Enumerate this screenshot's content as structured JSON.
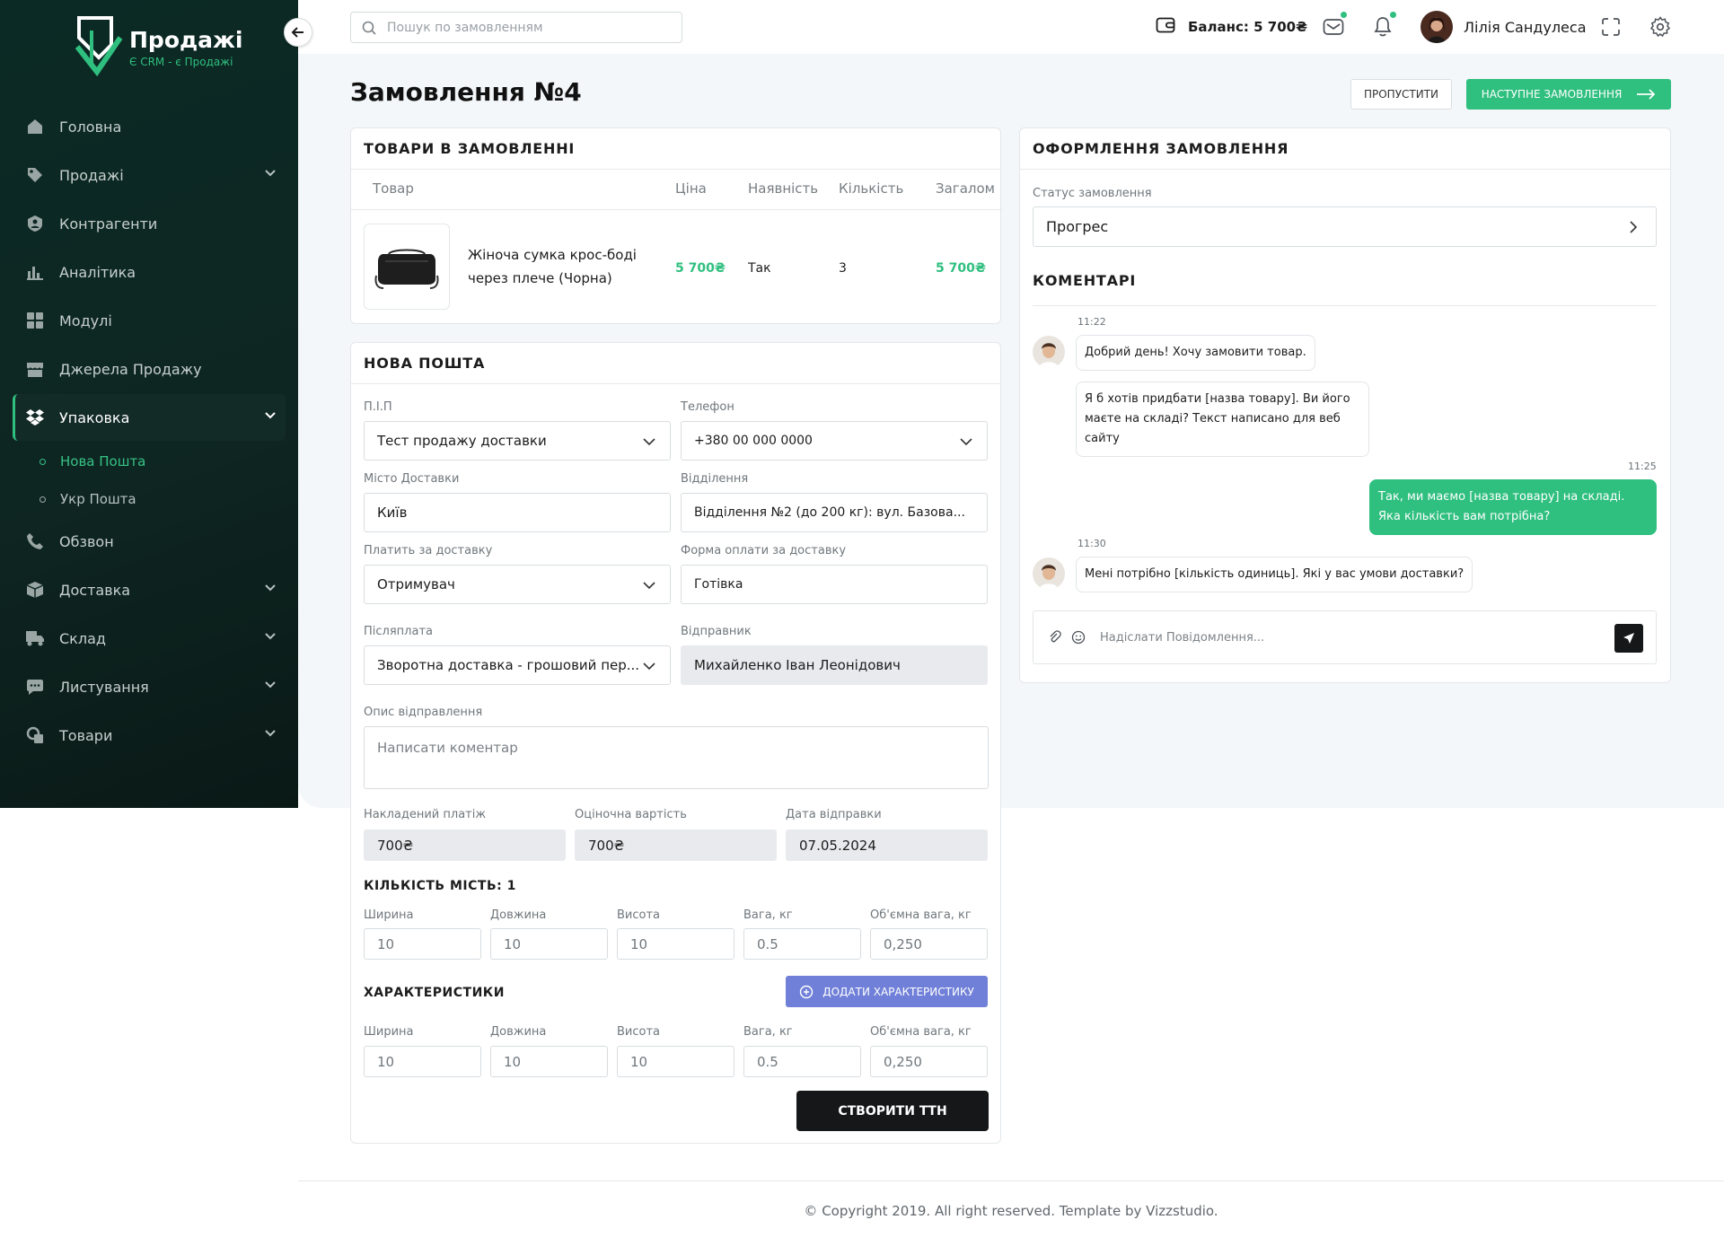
{
  "brand": {
    "title": "Продажі",
    "subtitle": "Є CRM - є Продажі"
  },
  "sidebar": {
    "items": [
      {
        "label": "Головна",
        "icon": "home-icon",
        "expandable": false
      },
      {
        "label": "Продажі",
        "icon": "sales-tag-icon",
        "expandable": true
      },
      {
        "label": "Контрагенти",
        "icon": "contractors-icon",
        "expandable": false
      },
      {
        "label": "Аналітика",
        "icon": "analytics-icon",
        "expandable": false
      },
      {
        "label": "Модулі",
        "icon": "modules-icon",
        "expandable": false
      },
      {
        "label": "Джерела Продажу",
        "icon": "store-icon",
        "expandable": false
      },
      {
        "label": "Упаковка",
        "icon": "dropbox-icon",
        "expandable": true,
        "active": true
      },
      {
        "label": "Обзвон",
        "icon": "phone-icon",
        "expandable": false
      },
      {
        "label": "Доставка",
        "icon": "box-icon",
        "expandable": true
      },
      {
        "label": "Склад",
        "icon": "warehouse-truck-icon",
        "expandable": true
      },
      {
        "label": "Листування",
        "icon": "chat-icon",
        "expandable": true
      },
      {
        "label": "Товари",
        "icon": "goods-icon",
        "expandable": true
      }
    ],
    "subitems": [
      {
        "label": "Нова Пошта",
        "active": true
      },
      {
        "label": "Укр Пошта",
        "active": false
      }
    ]
  },
  "header": {
    "search_placeholder": "Пошук по замовленням",
    "balance": "Баланс: 5 700₴",
    "user_name": "Лілія Сандулеса"
  },
  "page": {
    "title": "Замовлення №4",
    "skip_label": "ПРОПУСТИТИ",
    "next_label": "НАСТУПНЕ ЗАМОВЛЕННЯ"
  },
  "products": {
    "title": "ТОВАРИ В ЗАМОВЛЕННІ",
    "columns": [
      "Товар",
      "Ціна",
      "Наявність",
      "Кількість",
      "Загалом"
    ],
    "rows": [
      {
        "name": "Жіноча сумка крос-боді через плече (Чорна)",
        "price": "5 700₴",
        "availability": "Так",
        "quantity": "3",
        "total": "5 700₴"
      }
    ]
  },
  "nova_poshta": {
    "title": "НОВА ПОШТА",
    "pib_label": "П.І.П",
    "pib_value": "Тест продажу доставки",
    "phone_label": "Телефон",
    "phone_value": "+380 00 000 0000",
    "city_label": "Місто Доставки",
    "city_value": "Київ",
    "branch_label": "Відділення",
    "branch_value": "Відділення №2 (до 200 кг): вул. Базова...",
    "payer_label": "Платить за доставку",
    "payer_value": "Отримувач",
    "payment_form_label": "Форма оплати за доставку",
    "payment_form_value": "Готівка",
    "cod_label": "Післяплата",
    "cod_value": "Зворотна доставка - грошовий пер...",
    "sender_label": "Відправник",
    "sender_value": "Михайленко Іван Леонідович",
    "desc_label": "Опис відправлення",
    "desc_placeholder": "Написати коментар",
    "cod_amount_label": "Накладений платіж",
    "cod_amount_value": "700₴",
    "estimated_label": "Оціночна вартість",
    "estimated_value": "700₴",
    "date_label": "Дата відправки",
    "date_value": "07.05.2024",
    "places_title": "КІЛЬКІСТЬ МІСТЬ: 1",
    "dims_labels": [
      "Ширина",
      "Довжина",
      "Висота",
      "Вага, кг",
      "Об'ємна вага, кг"
    ],
    "dims_values": [
      "10",
      "10",
      "10",
      "0.5",
      "0,250"
    ],
    "characteristics_title": "ХАРАКТЕРИСТИКИ",
    "add_characteristic_label": "ДОДАТИ ХАРАКТЕРИСТИКУ",
    "dims2_labels": [
      "Ширина",
      "Довжина",
      "Висота",
      "Вага, кг",
      "Об'ємна вага, кг"
    ],
    "dims2_values": [
      "10",
      "10",
      "10",
      "0.5",
      "0,250"
    ],
    "create_ttn_label": "СТВОРИТИ ТТН"
  },
  "order": {
    "title": "ОФОРМЛЕННЯ ЗАМОВЛЕННЯ",
    "status_label": "Статус замовлення",
    "status_value": "Прогрес",
    "comments_title": "КОМЕНТАРІ",
    "messages": [
      {
        "time": "11:22",
        "direction": "in",
        "texts": [
          "Добрий день! Хочу замовити товар.",
          "Я б хотів придбати [назва товару]. Ви його маєте на складі? Текст написано для веб сайту"
        ]
      },
      {
        "time": "11:25",
        "direction": "out",
        "texts": [
          "Так, ми маємо [назва товару] на складі. Яка кількість вам потрібна?"
        ]
      },
      {
        "time": "11:30",
        "direction": "in",
        "texts": [
          "Мені потрібно [кількість одиниць]. Які у вас умови доставки?"
        ]
      }
    ],
    "composer_placeholder": "Надіслати Повідомлення..."
  },
  "footer": {
    "text": "© Copyright 2019. All right reserved. Template by Vizzstudio."
  },
  "colors": {
    "accent": "#2fbf7f",
    "sidebar": "#0e2622",
    "add_button": "#7080d8",
    "dark_button": "#151718"
  }
}
